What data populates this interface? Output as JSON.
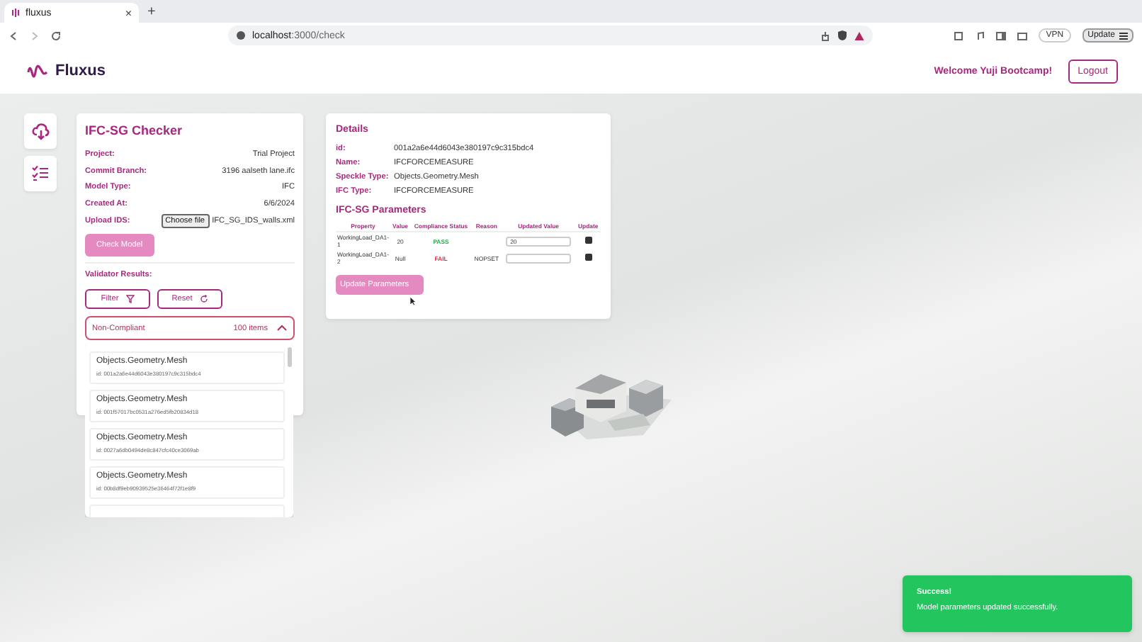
{
  "browser": {
    "tab_title": "fluxus",
    "new_tab": "+",
    "close": "×",
    "url_host": "localhost",
    "url_path": ":3000/check",
    "vpn": "VPN",
    "update": "Update"
  },
  "header": {
    "logo": "Fluxus",
    "welcome": "Welcome Yuji Bootcamp!",
    "logout": "Logout"
  },
  "rail": [
    {
      "kind": "upload"
    },
    {
      "kind": "checklist"
    }
  ],
  "checker": {
    "title": "IFC-SG Checker",
    "fields": [
      {
        "label": "Project:",
        "value": "Trial Project"
      },
      {
        "label": "Commit Branch:",
        "value": "3196 aalseth lane.ifc"
      },
      {
        "label": "Model Type:",
        "value": "IFC"
      },
      {
        "label": "Created At:",
        "value": "6/6/2024"
      }
    ],
    "upload_label": "Upload IDS:",
    "choose_file": "Choose file",
    "file_name": "IFC_SG_IDS_walls.xml",
    "check_model": "Check Model",
    "results_label": "Validator Results:",
    "filter": "Filter",
    "reset": "Reset",
    "dropdown": {
      "label": "Non-Compliant",
      "count": "100 items",
      "expanded": true
    },
    "items": [
      {
        "type": "Objects.Geometry.Mesh",
        "id": "id: 001a2a6e44d6043e380197c9c315bdc4"
      },
      {
        "type": "Objects.Geometry.Mesh",
        "id": "id: 001f57017bc0531a276ed5fb20834d18"
      },
      {
        "type": "Objects.Geometry.Mesh",
        "id": "id: 0027a6db0494de8c847cfc40ce3069ab"
      },
      {
        "type": "Objects.Geometry.Mesh",
        "id": "id: 00b8df9eb90939525e36464f72f1e8f9"
      }
    ]
  },
  "details": {
    "title": "Details",
    "fields": [
      {
        "label": "id:",
        "value": "001a2a6e44d6043e380197c9c315bdc4"
      },
      {
        "label": "Name:",
        "value": "IFCFORCEMEASURE"
      },
      {
        "label": "Speckle Type:",
        "value": "Objects.Geometry.Mesh"
      },
      {
        "label": "IFC Type:",
        "value": "IFCFORCEMEASURE"
      }
    ],
    "params_title": "IFC-SG Parameters",
    "columns": [
      "Property",
      "Value",
      "Compliance Status",
      "Reason",
      "Updated Value",
      "Update"
    ],
    "rows": [
      {
        "property": "WorkingLoad_DA1-1",
        "value": "20",
        "status": "PASS",
        "color": "#22b04c",
        "updated_value": "20",
        "checked": true
      },
      {
        "property": "WorkingLoad_DA1-2",
        "value": "Null",
        "status": "FAIL",
        "color": "#e0303a",
        "reason": "NOPSET",
        "updated_value": "",
        "checked": true
      }
    ],
    "update_button": "Update Parameters"
  },
  "toast": {
    "title": "Success!",
    "message": "Model parameters updated successfully."
  }
}
